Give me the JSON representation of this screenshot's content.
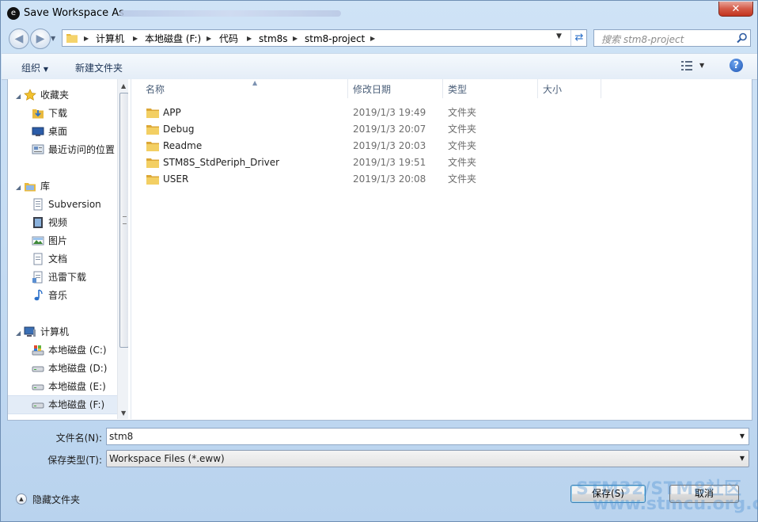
{
  "window": {
    "title": "Save Workspace As",
    "close_label": "✕"
  },
  "nav": {
    "breadcrumbs": [
      "计算机",
      "本地磁盘 (F:)",
      "代码",
      "stm8s",
      "stm8-project"
    ],
    "search_placeholder": "搜索 stm8-project"
  },
  "toolbar": {
    "organize": "组织",
    "new_folder": "新建文件夹",
    "help": "?"
  },
  "sidebar": {
    "favorites": {
      "label": "收藏夹",
      "items": [
        "下载",
        "桌面",
        "最近访问的位置"
      ]
    },
    "libraries": {
      "label": "库",
      "items": [
        "Subversion",
        "视频",
        "图片",
        "文档",
        "迅雷下载",
        "音乐"
      ]
    },
    "computer": {
      "label": "计算机",
      "items": [
        "本地磁盘 (C:)",
        "本地磁盘 (D:)",
        "本地磁盘 (E:)",
        "本地磁盘 (F:)"
      ]
    }
  },
  "columns": [
    "名称",
    "修改日期",
    "类型",
    "大小"
  ],
  "files": [
    {
      "name": "APP",
      "date": "2019/1/3 19:49",
      "type": "文件夹"
    },
    {
      "name": "Debug",
      "date": "2019/1/3 20:07",
      "type": "文件夹"
    },
    {
      "name": "Readme",
      "date": "2019/1/3 20:03",
      "type": "文件夹"
    },
    {
      "name": "STM8S_StdPeriph_Driver",
      "date": "2019/1/3 19:51",
      "type": "文件夹"
    },
    {
      "name": "USER",
      "date": "2019/1/3 20:08",
      "type": "文件夹"
    }
  ],
  "form": {
    "filename_label": "文件名(N):",
    "filename_value": "stm8",
    "filetype_label": "保存类型(T):",
    "filetype_value": "Workspace Files (*.eww)"
  },
  "footer": {
    "hide_folders": "隐藏文件夹",
    "save": "保存(S)",
    "cancel": "取消"
  },
  "watermark": {
    "line1": "STM32/STM8社区",
    "line2": "www.stmcu.org.cn"
  }
}
